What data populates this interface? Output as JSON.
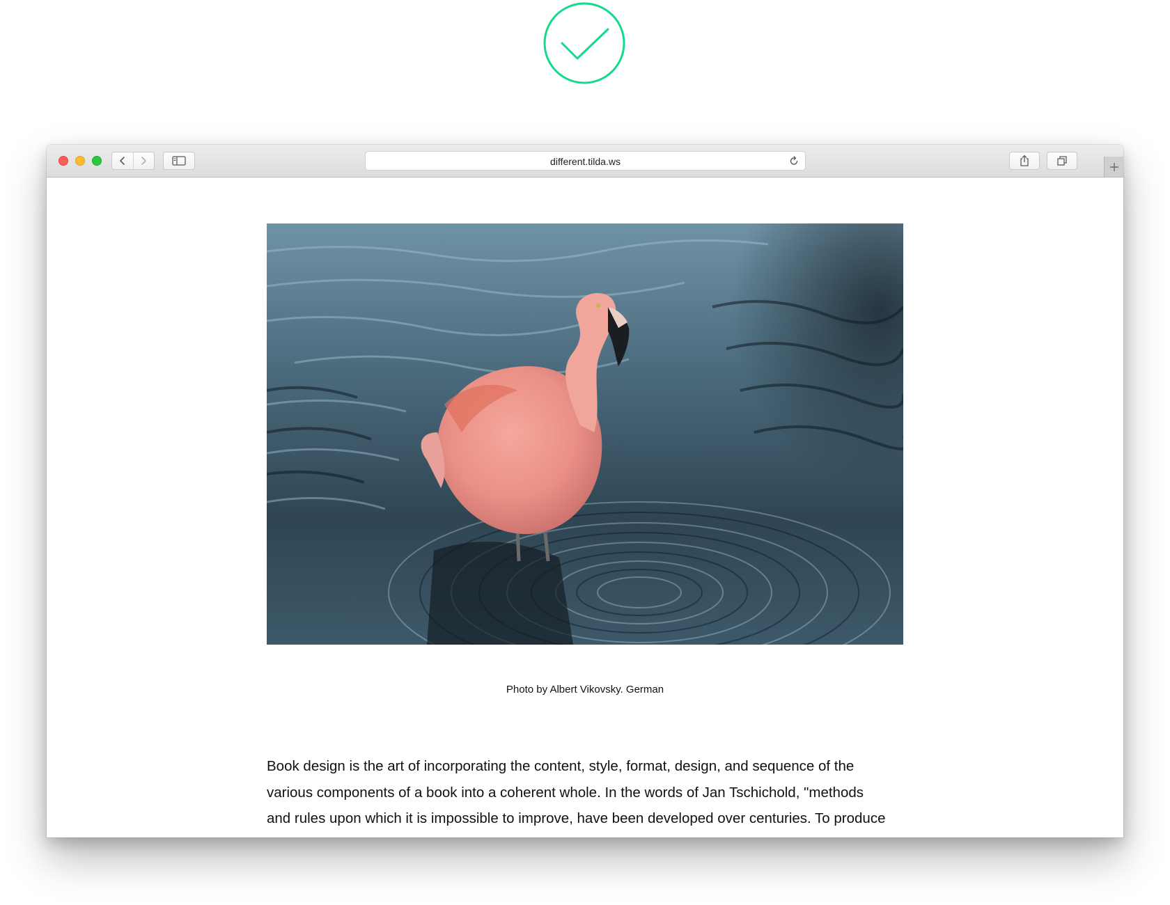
{
  "success_badge": {
    "icon": "checkmark-icon",
    "color": "#16d98a"
  },
  "browser": {
    "url": "different.tilda.ws",
    "buttons": {
      "close": "close-icon",
      "minimize": "minimize-icon",
      "maximize": "maximize-icon",
      "back": "chevron-left-icon",
      "forward": "chevron-right-icon",
      "sidebar": "sidebar-icon",
      "reload": "reload-icon",
      "share": "share-icon",
      "tabs": "tabs-overview-icon",
      "new_tab": "plus-icon"
    }
  },
  "page": {
    "image_alt": "Pink flamingo standing in rippling water",
    "caption": "Photo by Albert Vikovsky. German",
    "body": "Book design is the art of incorporating the content, style, format, design, and sequence of the\nvarious components of a book into a coherent whole. In the words of Jan Tschichold, \"methods\nand rules upon which it is impossible to improve, have been developed over centuries. To produce"
  }
}
